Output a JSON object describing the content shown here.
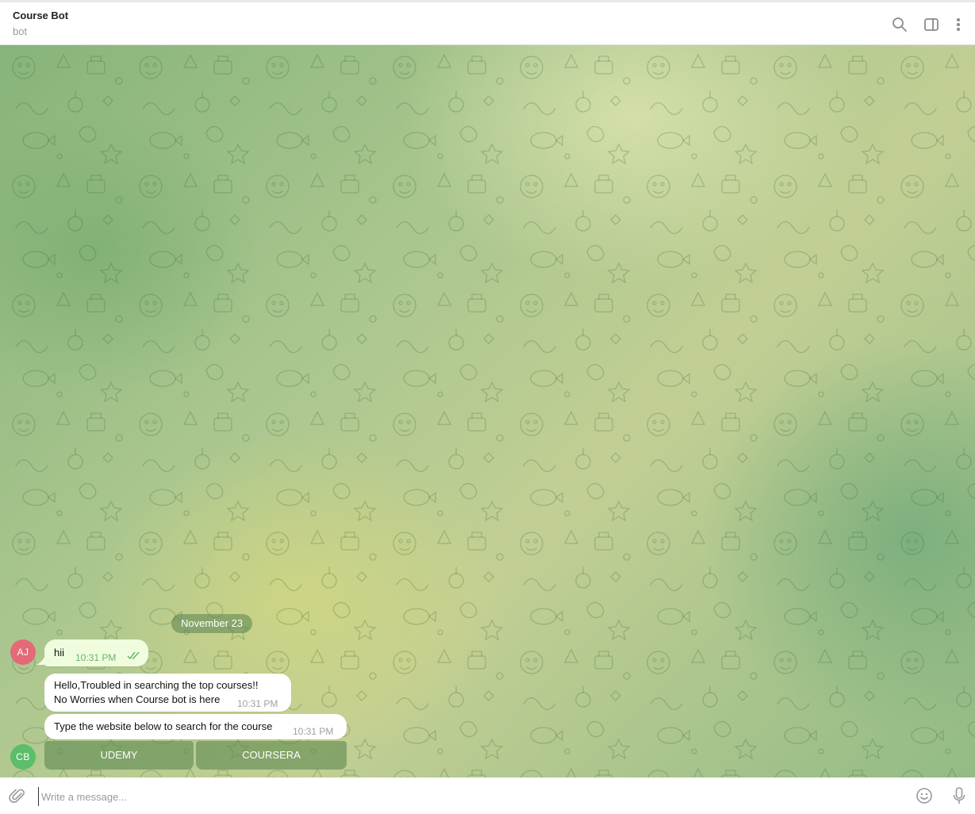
{
  "header": {
    "title": "Course Bot",
    "subtitle": "bot",
    "icons": [
      "search-icon",
      "sidebar-toggle-icon",
      "more-vertical-icon"
    ]
  },
  "chat": {
    "date_separator": "November 23",
    "messages": [
      {
        "sender_initials": "AJ",
        "direction": "outgoing",
        "text": "hii",
        "time": "10:31 PM",
        "status": "read"
      },
      {
        "direction": "incoming",
        "lines": [
          "Hello,Troubled in searching the top courses!!",
          "No Worries when Course bot is here"
        ],
        "time": "10:31 PM"
      },
      {
        "sender_initials": "CB",
        "direction": "incoming",
        "text": "Type the website below to search for the course",
        "time": "10:31 PM",
        "keyboard": [
          "UDEMY",
          "COURSERA"
        ]
      }
    ],
    "avatar_colors": {
      "AJ": "#e36a76",
      "CB": "#5cbd6a"
    }
  },
  "composer": {
    "value": "",
    "placeholder": "Write a message...",
    "icons": [
      "paperclip-icon",
      "emoji-icon",
      "microphone-icon"
    ]
  }
}
